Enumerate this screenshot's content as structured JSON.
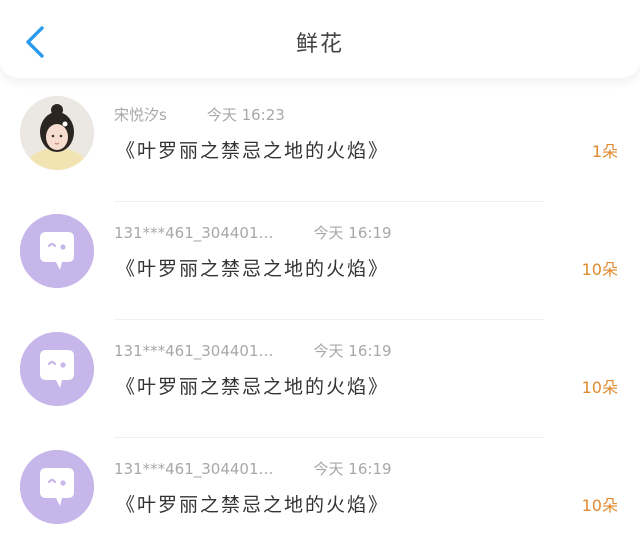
{
  "header": {
    "title": "鲜花",
    "back_icon": "chevron-left-icon",
    "accent_color": "#2b9bf0"
  },
  "items": [
    {
      "sender": "宋悦汐s",
      "time": "今天 16:23",
      "gift": "《叶罗丽之禁忌之地的火焰》",
      "count": "1朵",
      "avatar_icon": "user-photo"
    },
    {
      "sender": "131***461_304401…",
      "time": "今天 16:19",
      "gift": "《叶罗丽之禁忌之地的火焰》",
      "count": "10朵",
      "avatar_icon": "chat-bubble-face-icon"
    },
    {
      "sender": "131***461_304401…",
      "time": "今天 16:19",
      "gift": "《叶罗丽之禁忌之地的火焰》",
      "count": "10朵",
      "avatar_icon": "chat-bubble-face-icon"
    },
    {
      "sender": "131***461_304401…",
      "time": "今天 16:19",
      "gift": "《叶罗丽之禁忌之地的火焰》",
      "count": "10朵",
      "avatar_icon": "chat-bubble-face-icon"
    }
  ]
}
